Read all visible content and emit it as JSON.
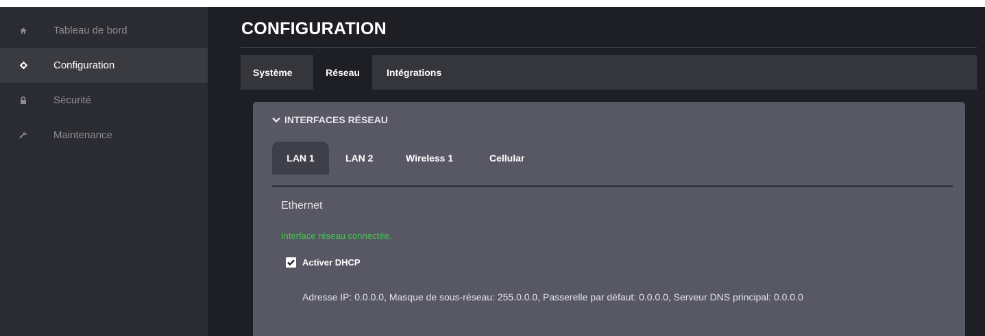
{
  "sidebar": {
    "items": [
      {
        "label": "Tableau de bord",
        "icon": "home-icon"
      },
      {
        "label": "Configuration",
        "icon": "gear-icon",
        "active": true
      },
      {
        "label": "Sécurité",
        "icon": "lock-icon"
      },
      {
        "label": "Maintenance",
        "icon": "wrench-icon"
      }
    ]
  },
  "header": {
    "title": "CONFIGURATION"
  },
  "tabs": [
    {
      "label": "Système"
    },
    {
      "label": "Réseau",
      "active": true
    },
    {
      "label": "Intégrations"
    }
  ],
  "panel": {
    "title": "INTERFACES RÉSEAU",
    "subtabs": [
      {
        "label": "LAN 1",
        "active": true
      },
      {
        "label": "LAN 2"
      },
      {
        "label": "Wireless 1"
      },
      {
        "label": "Cellular"
      }
    ],
    "interface_name": "Ethernet",
    "status": "Interface réseau connectée.",
    "dhcp_label": "Activer DHCP",
    "dhcp_checked": true,
    "network_info": "Adresse IP: 0.0.0.0, Masque de sous-réseau: 255.0.0.0, Passerelle par défaut: 0.0.0.0, Serveur DNS principal: 0.0.0.0"
  },
  "colors": {
    "sidebar_bg": "#2b2c31",
    "sidebar_active": "#3a3b41",
    "main_bg": "#1e1f24",
    "panel_bg": "#575864",
    "status_green": "#3ec84e"
  }
}
